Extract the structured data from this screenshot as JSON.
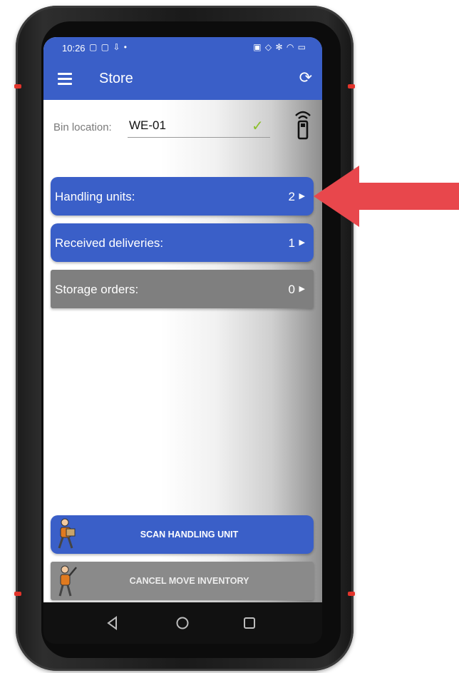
{
  "status_bar": {
    "time": "10:26",
    "left_icons": "▢ ▢ ⇩ •",
    "right_icons": "▣ ◇ ✻ ◠ ▭"
  },
  "app_bar": {
    "menu_icon": "hamburger-menu-icon",
    "title": "Store",
    "refresh_icon": "refresh-icon"
  },
  "bin_location": {
    "label": "Bin location:",
    "value": "WE-01",
    "check_icon": "checkmark-icon",
    "scanner_icon": "rfid-scanner-icon"
  },
  "list_rows": [
    {
      "label": "Handling units:",
      "count": "2",
      "style": "blue"
    },
    {
      "label": "Received deliveries:",
      "count": "1",
      "style": "blue"
    },
    {
      "label": "Storage orders:",
      "count": "0",
      "style": "grey"
    }
  ],
  "actions": {
    "scan_label": "SCAN HANDLING UNIT",
    "cancel_label": "CANCEL MOVE INVENTORY"
  },
  "nav_bar": {
    "back_icon": "back-triangle-icon",
    "home_icon": "home-circle-icon",
    "recents_icon": "recents-square-icon"
  },
  "colors": {
    "primary": "#3a5fc8",
    "secondary": "#7f7f7f",
    "accent_arrow": "#e8474c",
    "check": "#8bbf2a"
  }
}
